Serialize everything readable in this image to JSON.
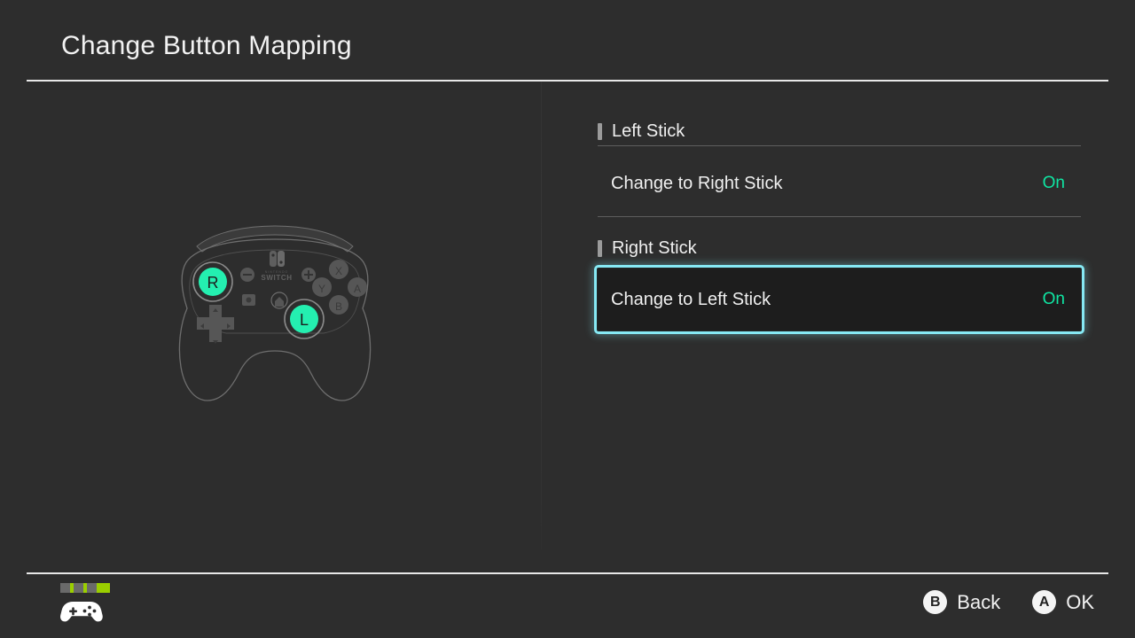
{
  "header": {
    "title": "Change Button Mapping"
  },
  "controller": {
    "device_name": "Pro Controller",
    "brand_text": "NINTENDO",
    "brand_wordmark": "SWITCH",
    "left_stick_label": "R",
    "right_stick_label": "L",
    "face_buttons": {
      "x": "X",
      "y": "Y",
      "a": "A",
      "b": "B"
    },
    "minus_icon": "minus-icon",
    "plus_icon": "plus-icon",
    "capture_icon": "capture-icon",
    "home_icon": "home-icon",
    "dpad_icon": "dpad-icon",
    "highlight_color": "#24efb0",
    "outline_color": "#7a7a7a",
    "button_color": "#565656"
  },
  "settings": {
    "groups": [
      {
        "id": "left-stick",
        "label": "Left Stick",
        "rows": [
          {
            "id": "change-to-right-stick",
            "label": "Change to Right Stick",
            "value": "On",
            "selected": false
          }
        ]
      },
      {
        "id": "right-stick",
        "label": "Right Stick",
        "rows": [
          {
            "id": "change-to-left-stick",
            "label": "Change to Left Stick",
            "value": "On",
            "selected": true
          }
        ]
      }
    ]
  },
  "footer": {
    "player_leds": [
      "#9ace00",
      "#6a6a6a",
      "#6a6a6a",
      "#6a6a6a"
    ],
    "gamepad_icon": "gamepad-icon",
    "hints": [
      {
        "key": "B",
        "label": "Back"
      },
      {
        "key": "A",
        "label": "OK"
      }
    ]
  },
  "colors": {
    "background": "#2d2d2d",
    "accent_on": "#0fe6a3",
    "selection_border": "#86e9f4",
    "selection_fill": "#1d1d1d",
    "text_primary": "#f0f0f0",
    "rule": "#e8e8e8"
  }
}
